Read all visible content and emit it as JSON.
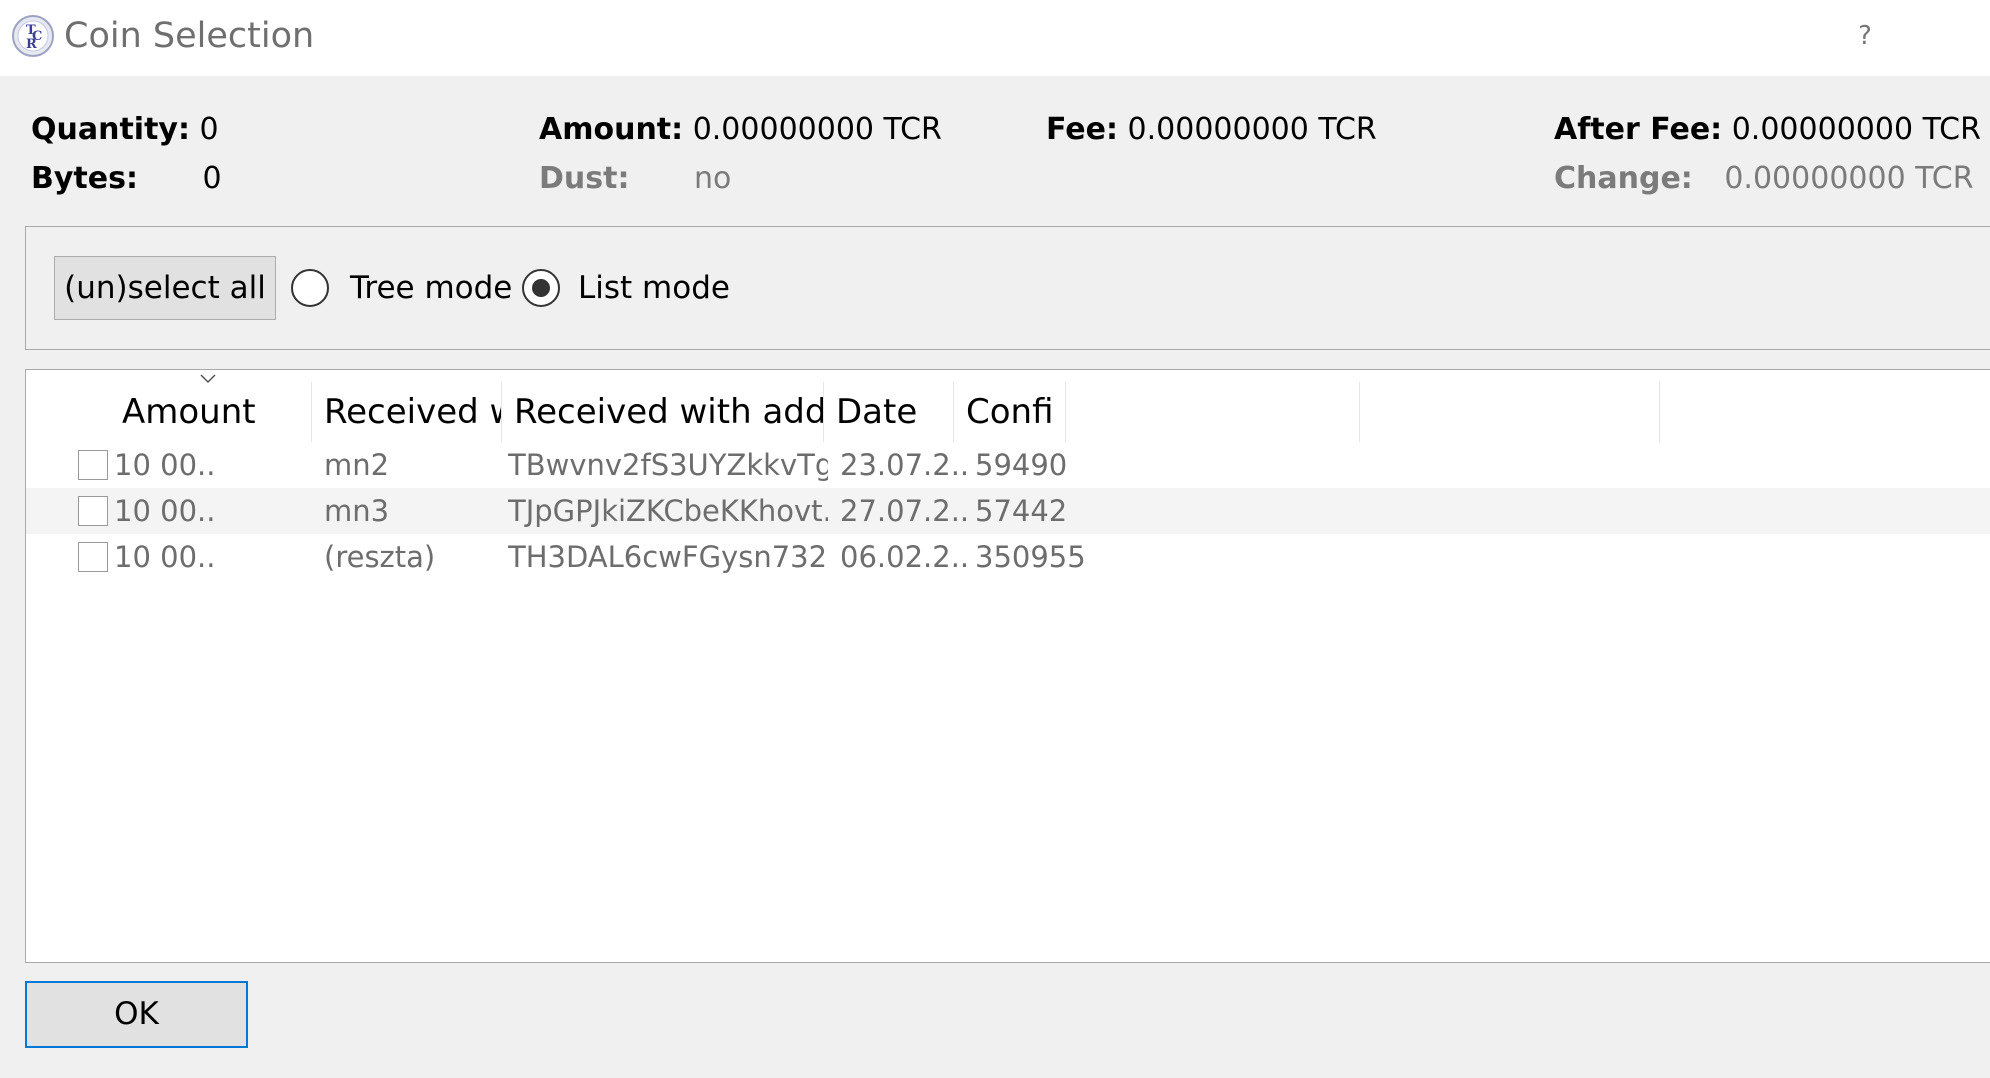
{
  "window": {
    "title": "Coin Selection",
    "help": "?",
    "icon": "tcr-app-icon"
  },
  "summary": {
    "quantity_label": "Quantity:",
    "quantity_value": "0",
    "bytes_label": "Bytes:",
    "bytes_value": "0",
    "amount_label": "Amount:",
    "amount_value": "0.00000000 TCR",
    "dust_label": "Dust:",
    "dust_value": "no",
    "fee_label": "Fee:",
    "fee_value": "0.00000000 TCR",
    "after_fee_label": "After Fee:",
    "after_fee_value": "0.00000000 TCR",
    "change_label": "Change:",
    "change_value": "0.00000000 TCR"
  },
  "controls": {
    "unselect_all": "(un)select all",
    "tree_mode": "Tree mode",
    "list_mode": "List mode",
    "selected_mode": "list"
  },
  "table": {
    "columns": [
      "Amount",
      "Received w",
      "Received with addr",
      "Date",
      "Confi"
    ],
    "rows": [
      {
        "amount": "10 00...",
        "label": "mn2",
        "address": "TBwvnv2fS3UYZkkvTg...",
        "date": "23.07.2...",
        "confirmations": "59490"
      },
      {
        "amount": "10 00...",
        "label": "mn3",
        "address": "TJpGPJkiZKCbeKKhovt...",
        "date": "27.07.2...",
        "confirmations": "57442"
      },
      {
        "amount": "10 00...",
        "label": "(reszta)",
        "address": "TH3DAL6cwFGysn732...",
        "date": "06.02.2...",
        "confirmations": "350955"
      }
    ]
  },
  "footer": {
    "ok": "OK"
  },
  "colors": {
    "accent": "#0078d7",
    "button_bg": "#e1e1e1",
    "window_bg": "#f0f0f0"
  }
}
